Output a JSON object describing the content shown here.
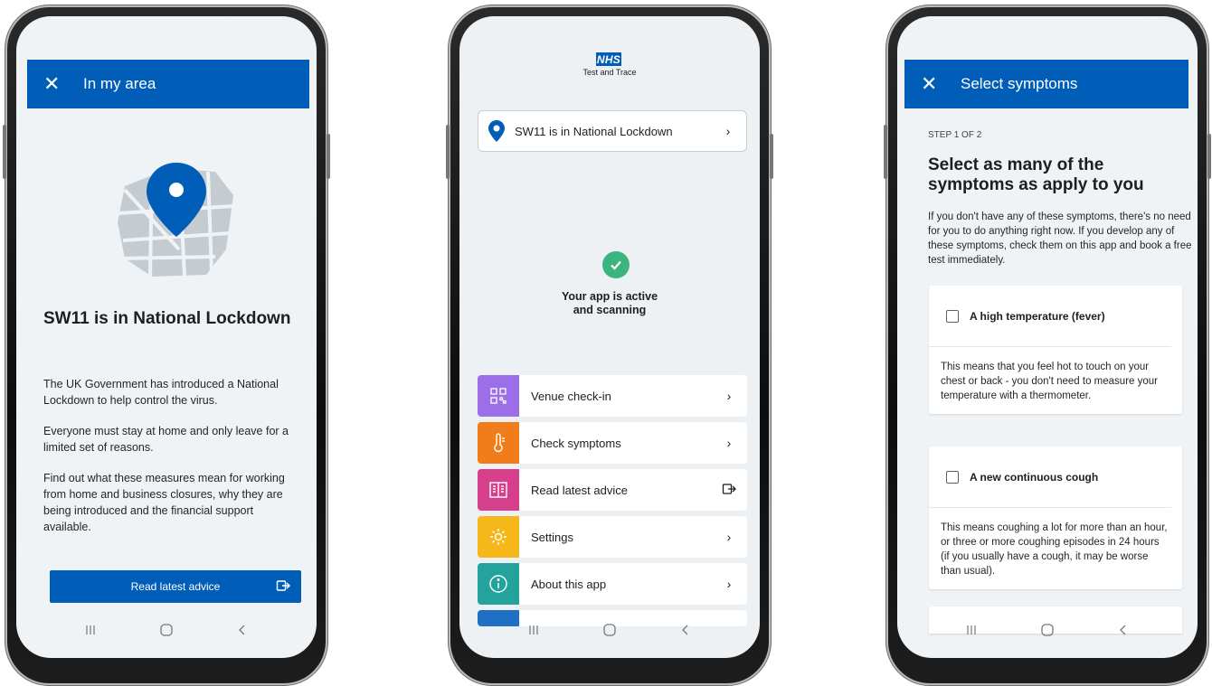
{
  "screen1": {
    "header_title": "In my area",
    "lockdown_title": "SW11 is in National Lockdown",
    "paragraphs": [
      "The UK Government has introduced a National Lockdown to help control the virus.",
      "Everyone must stay at home and only leave for a limited set of reasons.",
      "Find out what these measures mean for working from home and business closures, why they are being introduced and the financial support available."
    ],
    "button_label": "Read latest advice"
  },
  "screen2": {
    "logo_text": "NHS",
    "logo_sub": "Test and Trace",
    "area_status": "SW11 is in National Lockdown",
    "app_status_line1": "Your app is active",
    "app_status_line2": "and scanning",
    "menu": [
      {
        "label": "Venue check-in",
        "color": "#9c6ee8"
      },
      {
        "label": "Check symptoms",
        "color": "#f07d1a"
      },
      {
        "label": "Read latest advice",
        "color": "#d53f8c"
      },
      {
        "label": "Settings",
        "color": "#f5b71a"
      },
      {
        "label": "About this app",
        "color": "#23a39b"
      }
    ],
    "partial_tile_color": "#1f6fc2"
  },
  "screen3": {
    "header_title": "Select symptoms",
    "step": "STEP 1 OF 2",
    "title": "Select as many of the symptoms as apply to you",
    "intro": "If you don't have any of these symptoms, there's no need for you to do anything right now. If you develop any of these symptoms, check them on this app and book a free test immediately.",
    "symptoms": [
      {
        "name": "A high temperature (fever)",
        "desc": "This means that you feel hot to touch on your chest or back - you don't need to measure your temperature with a thermometer."
      },
      {
        "name": "A new continuous cough",
        "desc": "This means coughing a lot for more than an hour, or three or more coughing episodes in 24 hours (if you usually have a cough, it may be worse than usual)."
      }
    ]
  },
  "colors": {
    "nhs_blue": "#005eb8",
    "success_green": "#3bb480"
  }
}
